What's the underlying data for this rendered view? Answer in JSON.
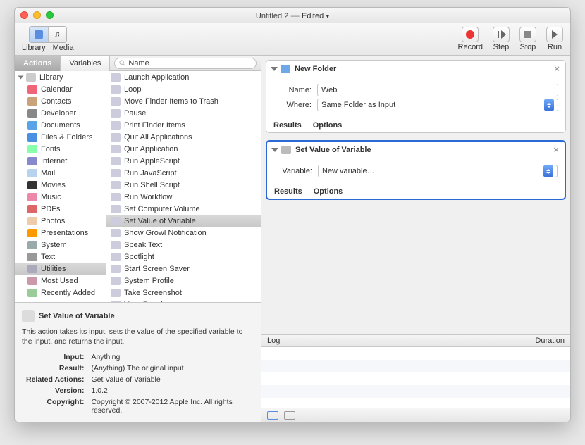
{
  "window": {
    "title": "Untitled 2",
    "status": "Edited"
  },
  "toolbar": {
    "library": "Library",
    "media": "Media",
    "record": "Record",
    "step": "Step",
    "stop": "Stop",
    "run": "Run"
  },
  "tabs": {
    "actions": "Actions",
    "variables": "Variables"
  },
  "search": {
    "placeholder": "Name"
  },
  "library": {
    "root": "Library",
    "items": [
      {
        "label": "Calendar",
        "c": "#e67"
      },
      {
        "label": "Contacts",
        "c": "#caa37a"
      },
      {
        "label": "Developer",
        "c": "#888"
      },
      {
        "label": "Documents",
        "c": "#5aa3e6"
      },
      {
        "label": "Files & Folders",
        "c": "#4a90e2"
      },
      {
        "label": "Fonts",
        "c": "#8fa"
      },
      {
        "label": "Internet",
        "c": "#88c"
      },
      {
        "label": "Mail",
        "c": "#b7d3ef"
      },
      {
        "label": "Movies",
        "c": "#333"
      },
      {
        "label": "Music",
        "c": "#e8a"
      },
      {
        "label": "PDFs",
        "c": "#d66"
      },
      {
        "label": "Photos",
        "c": "#eca"
      },
      {
        "label": "Presentations",
        "c": "#f90"
      },
      {
        "label": "System",
        "c": "#9aa"
      },
      {
        "label": "Text",
        "c": "#999"
      },
      {
        "label": "Utilities",
        "c": "#aab",
        "sel": true
      },
      {
        "label": "Most Used",
        "c": "#c9a"
      },
      {
        "label": "Recently Added",
        "c": "#9c9"
      }
    ]
  },
  "actions": [
    "Launch Application",
    "Loop",
    "Move Finder Items to Trash",
    "Pause",
    "Print Finder Items",
    "Quit All Applications",
    "Quit Application",
    "Run AppleScript",
    "Run JavaScript",
    "Run Shell Script",
    "Run Workflow",
    "Set Computer Volume",
    "Set Value of Variable",
    "Show Growl Notification",
    "Speak Text",
    "Spotlight",
    "Start Screen Saver",
    "System Profile",
    "Take Screenshot",
    "View Results"
  ],
  "actions_selected": "Set Value of Variable",
  "info": {
    "title": "Set Value of Variable",
    "desc": "This action takes its input, sets the value of the specified variable to the input, and returns the input.",
    "rows": {
      "input_l": "Input:",
      "input": "Anything",
      "result_l": "Result:",
      "result": "(Anything) The original input",
      "related_l": "Related Actions:",
      "related": "Get Value of Variable",
      "version_l": "Version:",
      "version": "1.0.2",
      "copyright_l": "Copyright:",
      "copyright": "Copyright © 2007-2012 Apple Inc.  All rights reserved."
    }
  },
  "workflow": {
    "card1": {
      "title": "New Folder",
      "name_l": "Name:",
      "name_v": "Web",
      "where_l": "Where:",
      "where_v": "Same Folder as Input",
      "results": "Results",
      "options": "Options"
    },
    "card2": {
      "title": "Set Value of Variable",
      "var_l": "Variable:",
      "var_v": "New variable…",
      "results": "Results",
      "options": "Options"
    }
  },
  "log": {
    "log": "Log",
    "duration": "Duration"
  }
}
